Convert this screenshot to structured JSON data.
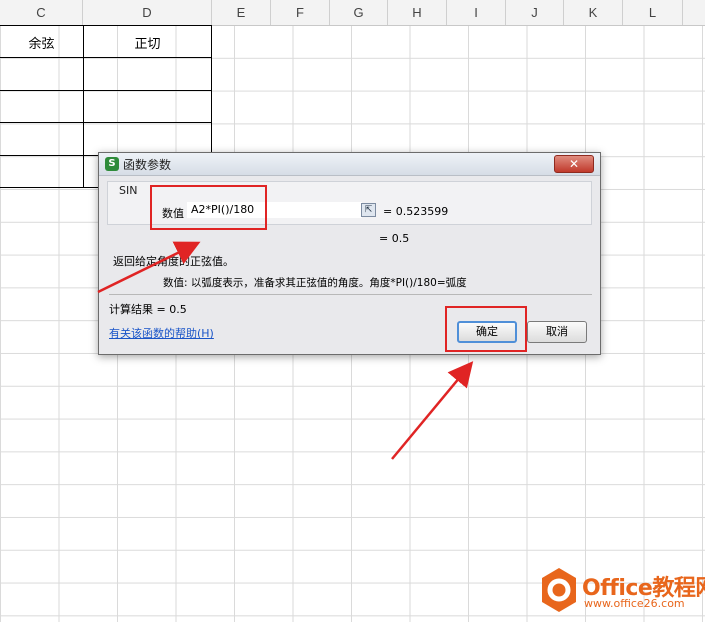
{
  "sheet": {
    "columns": [
      "C",
      "D",
      "E",
      "F",
      "G",
      "H",
      "I",
      "J",
      "K",
      "L"
    ],
    "cells": {
      "c1": "余弦",
      "d1": "正切"
    }
  },
  "dialog": {
    "title": "函数参数",
    "function_name": "SIN",
    "arg_label": "数值",
    "arg_value": "A2*PI()/180",
    "arg_result": "= 0.523599",
    "total_result": "= 0.5",
    "description": "返回给定角度的正弦值。",
    "param_description": "数值:  以弧度表示，准备求其正弦值的角度。角度*PI()/180=弧度",
    "calc_result": "计算结果 =  0.5",
    "help_link": "有关该函数的帮助(H)",
    "ok_label": "确定",
    "cancel_label": "取消",
    "close_label": "✕"
  },
  "watermark": {
    "title": "Office教程网",
    "url": "www.office26.com"
  },
  "colors": {
    "highlight_red": "#e02424",
    "watermark_orange": "#e8661c"
  }
}
